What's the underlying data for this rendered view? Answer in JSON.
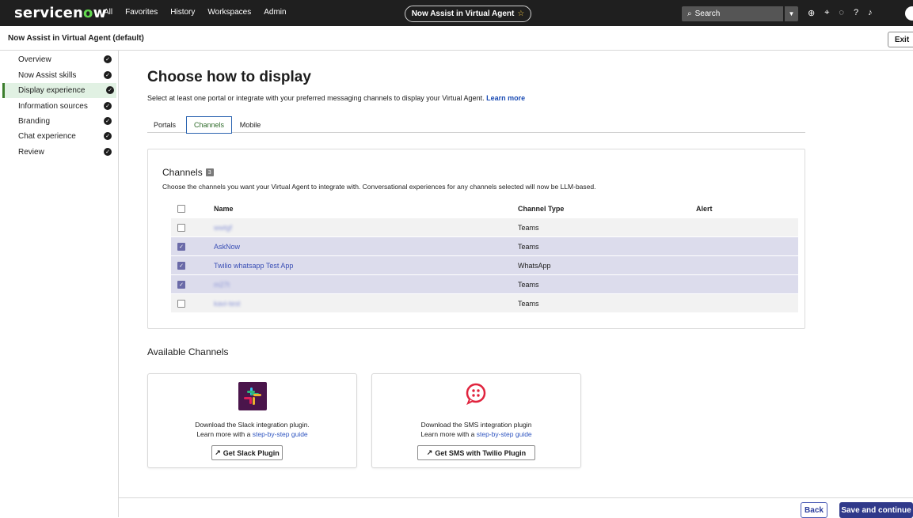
{
  "topbar": {
    "logo_prefix": "servicen",
    "logo_o": "o",
    "logo_suffix": "w",
    "nav": [
      "All",
      "Favorites",
      "History",
      "Workspaces",
      "Admin"
    ],
    "app_pill": "Now Assist in Virtual Agent",
    "search_label": "Search",
    "brand_color": "#62d84e"
  },
  "subheader": {
    "title": "Now Assist in Virtual Agent (default)",
    "exit_label": "Exit"
  },
  "sidebar": {
    "items": [
      {
        "label": "Overview"
      },
      {
        "label": "Now Assist skills"
      },
      {
        "label": "Display experience",
        "active": true
      },
      {
        "label": "Information sources"
      },
      {
        "label": "Branding"
      },
      {
        "label": "Chat experience"
      },
      {
        "label": "Review"
      }
    ]
  },
  "main": {
    "title": "Choose how to display",
    "subtitle": "Select at least one portal or integrate with your preferred messaging channels to display your Virtual Agent.",
    "learn_more": "Learn more",
    "tabs": [
      {
        "label": "Portals"
      },
      {
        "label": "Channels",
        "active": true
      },
      {
        "label": "Mobile"
      }
    ]
  },
  "channels": {
    "title": "Channels",
    "count": "3",
    "description": "Choose the channels you want your Virtual Agent to integrate with. Conversational experiences for any channels selected will now be LLM-based.",
    "headers": {
      "name": "Name",
      "type": "Channel Type",
      "alert": "Alert"
    },
    "rows": [
      {
        "name": "wwtgf",
        "type": "Teams",
        "checked": false,
        "blurred": true
      },
      {
        "name": "AskNow",
        "type": "Teams",
        "checked": true,
        "blurred": false
      },
      {
        "name": "Twilio whatsapp Test App",
        "type": "WhatsApp",
        "checked": true,
        "blurred": false
      },
      {
        "name": "m27t",
        "type": "Teams",
        "checked": true,
        "blurred": true
      },
      {
        "name": "kavi-test",
        "type": "Teams",
        "checked": false,
        "blurred": true
      }
    ]
  },
  "available": {
    "title": "Available Channels",
    "slack": {
      "line1": "Download the Slack integration plugin.",
      "line2_prefix": "Learn more with a ",
      "link": "step-by-step guide",
      "button": "Get Slack Plugin"
    },
    "sms": {
      "line1": "Download the SMS integration plugin",
      "line2_prefix": "Learn more with a ",
      "link": "step-by-step guide",
      "button": "Get SMS with Twilio Plugin"
    }
  },
  "footer": {
    "back_label": "Back",
    "save_label": "Save and continue"
  }
}
